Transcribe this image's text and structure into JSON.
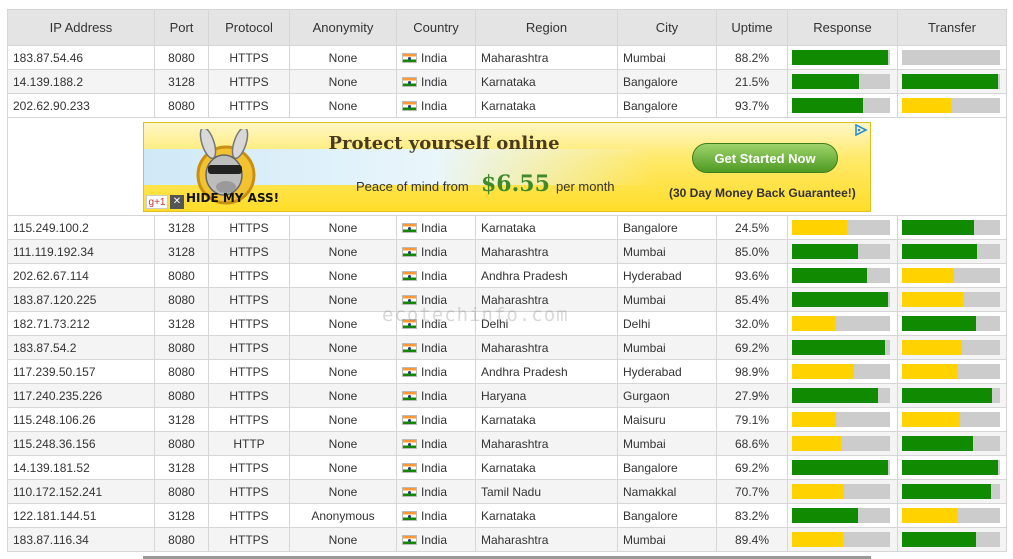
{
  "table": {
    "headers": [
      "IP Address",
      "Port",
      "Protocol",
      "Anonymity",
      "Country",
      "Region",
      "City",
      "Uptime",
      "Response",
      "Transfer"
    ],
    "colors": {
      "green": "#108a00",
      "yellow": "#ffd200",
      "track": "#cccccc"
    },
    "flag_icon": "india-flag-icon",
    "rows_top": [
      {
        "ip": "183.87.54.46",
        "port": "8080",
        "protocol": "HTTPS",
        "anonymity": "None",
        "country": "India",
        "region": "Maharashtra",
        "city": "Mumbai",
        "uptime": "88.2%",
        "response": {
          "level": 0.98,
          "color": "green"
        },
        "transfer": {
          "level": 0.0,
          "color": "yellow"
        }
      },
      {
        "ip": "14.139.188.2",
        "port": "3128",
        "protocol": "HTTPS",
        "anonymity": "None",
        "country": "India",
        "region": "Karnataka",
        "city": "Bangalore",
        "uptime": "21.5%",
        "response": {
          "level": 0.68,
          "color": "green"
        },
        "transfer": {
          "level": 0.98,
          "color": "green"
        }
      },
      {
        "ip": "202.62.90.233",
        "port": "8080",
        "protocol": "HTTPS",
        "anonymity": "None",
        "country": "India",
        "region": "Karnataka",
        "city": "Bangalore",
        "uptime": "93.7%",
        "response": {
          "level": 0.72,
          "color": "green"
        },
        "transfer": {
          "level": 0.5,
          "color": "yellow"
        }
      }
    ],
    "rows_bottom": [
      {
        "ip": "115.249.100.2",
        "port": "3128",
        "protocol": "HTTPS",
        "anonymity": "None",
        "country": "India",
        "region": "Karnataka",
        "city": "Bangalore",
        "uptime": "24.5%",
        "response": {
          "level": 0.56,
          "color": "yellow"
        },
        "transfer": {
          "level": 0.73,
          "color": "green"
        }
      },
      {
        "ip": "111.119.192.34",
        "port": "3128",
        "protocol": "HTTPS",
        "anonymity": "None",
        "country": "India",
        "region": "Maharashtra",
        "city": "Mumbai",
        "uptime": "85.0%",
        "response": {
          "level": 0.67,
          "color": "green"
        },
        "transfer": {
          "level": 0.77,
          "color": "green"
        }
      },
      {
        "ip": "202.62.67.114",
        "port": "8080",
        "protocol": "HTTPS",
        "anonymity": "None",
        "country": "India",
        "region": "Andhra Pradesh",
        "city": "Hyderabad",
        "uptime": "93.6%",
        "response": {
          "level": 0.77,
          "color": "green"
        },
        "transfer": {
          "level": 0.53,
          "color": "yellow"
        }
      },
      {
        "ip": "183.87.120.225",
        "port": "8080",
        "protocol": "HTTPS",
        "anonymity": "None",
        "country": "India",
        "region": "Maharashtra",
        "city": "Mumbai",
        "uptime": "85.4%",
        "response": {
          "level": 0.98,
          "color": "green"
        },
        "transfer": {
          "level": 0.62,
          "color": "yellow"
        }
      },
      {
        "ip": "182.71.73.212",
        "port": "3128",
        "protocol": "HTTPS",
        "anonymity": "None",
        "country": "India",
        "region": "Delhi",
        "city": "Delhi",
        "uptime": "32.0%",
        "response": {
          "level": 0.44,
          "color": "yellow"
        },
        "transfer": {
          "level": 0.76,
          "color": "green"
        }
      },
      {
        "ip": "183.87.54.2",
        "port": "8080",
        "protocol": "HTTPS",
        "anonymity": "None",
        "country": "India",
        "region": "Maharashtra",
        "city": "Mumbai",
        "uptime": "69.2%",
        "response": {
          "level": 0.95,
          "color": "green"
        },
        "transfer": {
          "level": 0.61,
          "color": "yellow"
        }
      },
      {
        "ip": "117.239.50.157",
        "port": "8080",
        "protocol": "HTTPS",
        "anonymity": "None",
        "country": "India",
        "region": "Andhra Pradesh",
        "city": "Hyderabad",
        "uptime": "98.9%",
        "response": {
          "level": 0.63,
          "color": "yellow"
        },
        "transfer": {
          "level": 0.56,
          "color": "yellow"
        }
      },
      {
        "ip": "117.240.235.226",
        "port": "8080",
        "protocol": "HTTPS",
        "anonymity": "None",
        "country": "India",
        "region": "Haryana",
        "city": "Gurgaon",
        "uptime": "27.9%",
        "response": {
          "level": 0.88,
          "color": "green"
        },
        "transfer": {
          "level": 0.92,
          "color": "green"
        }
      },
      {
        "ip": "115.248.106.26",
        "port": "3128",
        "protocol": "HTTPS",
        "anonymity": "None",
        "country": "India",
        "region": "Karnataka",
        "city": "Maisuru",
        "uptime": "79.1%",
        "response": {
          "level": 0.45,
          "color": "yellow"
        },
        "transfer": {
          "level": 0.59,
          "color": "yellow"
        }
      },
      {
        "ip": "115.248.36.156",
        "port": "8080",
        "protocol": "HTTP",
        "anonymity": "None",
        "country": "India",
        "region": "Maharashtra",
        "city": "Mumbai",
        "uptime": "68.6%",
        "response": {
          "level": 0.5,
          "color": "yellow"
        },
        "transfer": {
          "level": 0.72,
          "color": "green"
        }
      },
      {
        "ip": "14.139.181.52",
        "port": "3128",
        "protocol": "HTTPS",
        "anonymity": "None",
        "country": "India",
        "region": "Karnataka",
        "city": "Bangalore",
        "uptime": "69.2%",
        "response": {
          "level": 0.98,
          "color": "green"
        },
        "transfer": {
          "level": 0.98,
          "color": "green"
        }
      },
      {
        "ip": "110.172.152.241",
        "port": "8080",
        "protocol": "HTTPS",
        "anonymity": "None",
        "country": "India",
        "region": "Tamil Nadu",
        "city": "Namakkal",
        "uptime": "70.7%",
        "response": {
          "level": 0.53,
          "color": "yellow"
        },
        "transfer": {
          "level": 0.91,
          "color": "green"
        }
      },
      {
        "ip": "122.181.144.51",
        "port": "3128",
        "protocol": "HTTPS",
        "anonymity": "Anonymous",
        "country": "India",
        "region": "Karnataka",
        "city": "Bangalore",
        "uptime": "83.2%",
        "response": {
          "level": 0.67,
          "color": "green"
        },
        "transfer": {
          "level": 0.56,
          "color": "yellow"
        }
      },
      {
        "ip": "183.87.116.34",
        "port": "8080",
        "protocol": "HTTPS",
        "anonymity": "None",
        "country": "India",
        "region": "Maharashtra",
        "city": "Mumbai",
        "uptime": "89.4%",
        "response": {
          "level": 0.52,
          "color": "yellow"
        },
        "transfer": {
          "level": 0.75,
          "color": "green"
        }
      }
    ]
  },
  "ad": {
    "title": "Protect yourself online",
    "peace": "Peace of mind from",
    "price": "$6.55",
    "per": "per month",
    "cta": "Get Started Now",
    "guarantee": "(30 Day Money Back Guarantee!)",
    "logo_text": "HIDE MY ASS!",
    "gplus": "g+1",
    "close": "✕",
    "adchoices_icon": "adchoices-icon",
    "colors": {
      "bg": "#ffe96a",
      "cta": "#4e9a23"
    }
  },
  "watermark": "ecotechinfo.com"
}
